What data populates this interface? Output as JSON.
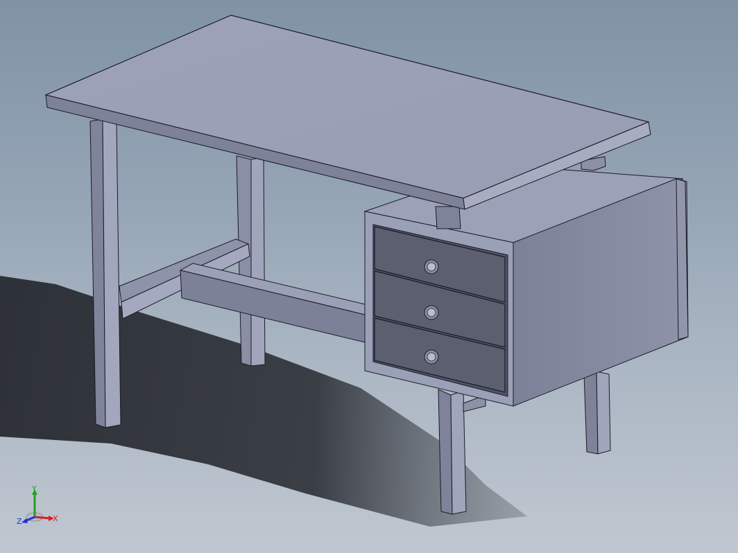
{
  "viewport": {
    "background_top": "#7f93a4",
    "background_bottom": "#c0c7d0"
  },
  "model": {
    "part_colors": {
      "face_light": "#9ba0b8",
      "face_mid": "#8c91a8",
      "face_dark": "#6f748a",
      "drawer_front": "#55596a",
      "edge": "#1a1a24",
      "shadow": "#2d3036"
    },
    "components": [
      "desktop",
      "front-left-leg",
      "back-left-leg",
      "front-right-leg",
      "back-right-leg",
      "stretcher",
      "drawer-cabinet",
      "drawer-1",
      "drawer-2",
      "drawer-3"
    ]
  },
  "triad": {
    "x_label": "X",
    "y_label": "Y",
    "z_label": "Z",
    "x_color": "#d22222",
    "y_color": "#22a022",
    "z_color": "#2233cc"
  }
}
